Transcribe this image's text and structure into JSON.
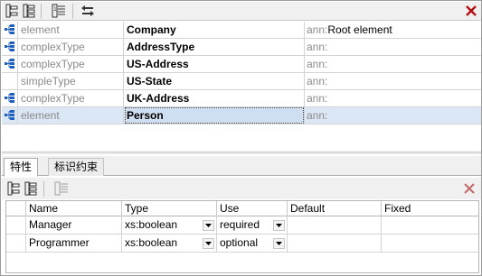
{
  "toolbar": {
    "buttons": [
      {
        "icon": "insert-icon"
      },
      {
        "icon": "append-icon"
      },
      {
        "icon": "add-child-icon"
      },
      {
        "icon": "sort-icon"
      }
    ],
    "close_icon": "delete-icon",
    "sort_icon_glyph": "↔"
  },
  "components": {
    "ann_label": "ann:",
    "rows": [
      {
        "kind": "element",
        "name": "Company",
        "ann": "Root element",
        "has_icon": true
      },
      {
        "kind": "complexType",
        "name": "AddressType",
        "ann": "",
        "has_icon": true
      },
      {
        "kind": "complexType",
        "name": "US-Address",
        "ann": "",
        "has_icon": true
      },
      {
        "kind": "simpleType",
        "name": "US-State",
        "ann": "",
        "has_icon": false
      },
      {
        "kind": "complexType",
        "name": "UK-Address",
        "ann": "",
        "has_icon": true
      },
      {
        "kind": "element",
        "name": "Person",
        "ann": "",
        "has_icon": true,
        "selected": true
      }
    ]
  },
  "tabs": [
    {
      "label": "特性",
      "active": true
    },
    {
      "label": "标识约束",
      "active": false
    }
  ],
  "attributes": {
    "columns": [
      "Name",
      "Type",
      "Use",
      "Default",
      "Fixed"
    ],
    "rows": [
      {
        "name": "Manager",
        "type": "xs:boolean",
        "use": "required",
        "default": "",
        "fixed": ""
      },
      {
        "name": "Programmer",
        "type": "xs:boolean",
        "use": "optional",
        "default": "",
        "fixed": ""
      }
    ]
  },
  "colors": {
    "selection": "#dce7f5",
    "icon_blue": "#1f5fbf",
    "delete_red": "#b01010"
  }
}
